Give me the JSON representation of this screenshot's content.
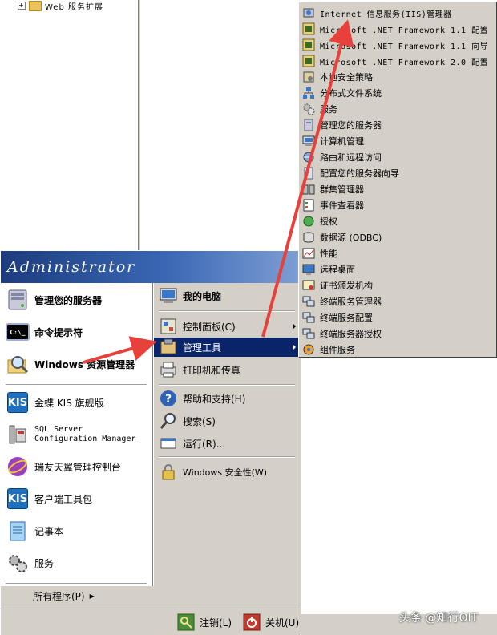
{
  "explorer": {
    "tree_item": "Web 服务扩展"
  },
  "start_menu": {
    "user": "Administrator",
    "pinned": [
      {
        "label": "管理您的服务器"
      },
      {
        "label": "命令提示符"
      },
      {
        "label": "Windows 资源管理器"
      }
    ],
    "recent": [
      {
        "label": "金蝶 KIS 旗舰版"
      },
      {
        "label_line1": "SQL Server",
        "label_line2": "Configuration Manager"
      },
      {
        "label": "瑞友天翼管理控制台"
      },
      {
        "label": "客户端工具包"
      },
      {
        "label": "记事本"
      },
      {
        "label": "服务"
      }
    ],
    "all_programs": "所有程序(P)",
    "right": {
      "my_computer": "我的电脑",
      "control_panel": "控制面板(C)",
      "admin_tools": "管理工具",
      "printers": "打印机和传真",
      "help": "帮助和支持(H)",
      "search": "搜索(S)",
      "run": "运行(R)...",
      "security": "Windows 安全性(W)"
    },
    "logoff": "注销(L)",
    "shutdown": "关机(U)"
  },
  "submenu": {
    "items": [
      {
        "label": "Internet 信息服务(IIS)管理器",
        "mono": true
      },
      {
        "label": "Microsoft .NET Framework 1.1 配置",
        "mono": true
      },
      {
        "label": "Microsoft .NET Framework 1.1 向导",
        "mono": true
      },
      {
        "label": "Microsoft .NET Framework 2.0 配置",
        "mono": true
      },
      {
        "label": "本地安全策略"
      },
      {
        "label": "分布式文件系统"
      },
      {
        "label": "服务"
      },
      {
        "label": "管理您的服务器"
      },
      {
        "label": "计算机管理"
      },
      {
        "label": "路由和远程访问"
      },
      {
        "label": "配置您的服务器向导"
      },
      {
        "label": "群集管理器"
      },
      {
        "label": "事件查看器"
      },
      {
        "label": "授权"
      },
      {
        "label": "数据源 (ODBC)"
      },
      {
        "label": "性能"
      },
      {
        "label": "远程桌面"
      },
      {
        "label": "证书颁发机构"
      },
      {
        "label": "终端服务管理器"
      },
      {
        "label": "终端服务配置"
      },
      {
        "label": "终端服务器授权"
      },
      {
        "label": "组件服务"
      }
    ]
  },
  "watermark": "头条 @知行OIT",
  "colors": {
    "highlight": "#0a246a",
    "menu_bg": "#d4d0c8",
    "arrow": "#e8413c",
    "banner": "#1c3c7e"
  }
}
